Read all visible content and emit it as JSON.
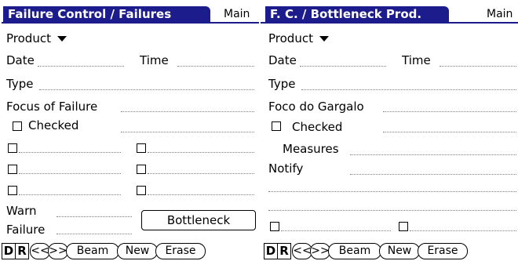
{
  "left": {
    "title": "Failure Control / Failures",
    "menu": "Main",
    "product_label": "Product",
    "date_label": "Date",
    "time_label": "Time",
    "type_label": "Type",
    "focus_label": "Focus of Failure",
    "checked_label": "Checked",
    "warn_label": "Warn",
    "failure_label": "Failure",
    "bottleneck_button": "Bottleneck"
  },
  "right": {
    "title": "F. C. / Bottleneck Prod.",
    "menu": "Main",
    "product_label": "Product",
    "date_label": "Date",
    "time_label": "Time",
    "type_label": "Type",
    "focus_label": "Foco do Gargalo",
    "checked_label": "Checked",
    "measures_label": "Measures",
    "notify_label": "Notify"
  },
  "toolbar": {
    "d": "D",
    "r": "R",
    "prev": "<<",
    "next": ">>",
    "beam": "Beam",
    "new": "New",
    "erase": "Erase"
  }
}
